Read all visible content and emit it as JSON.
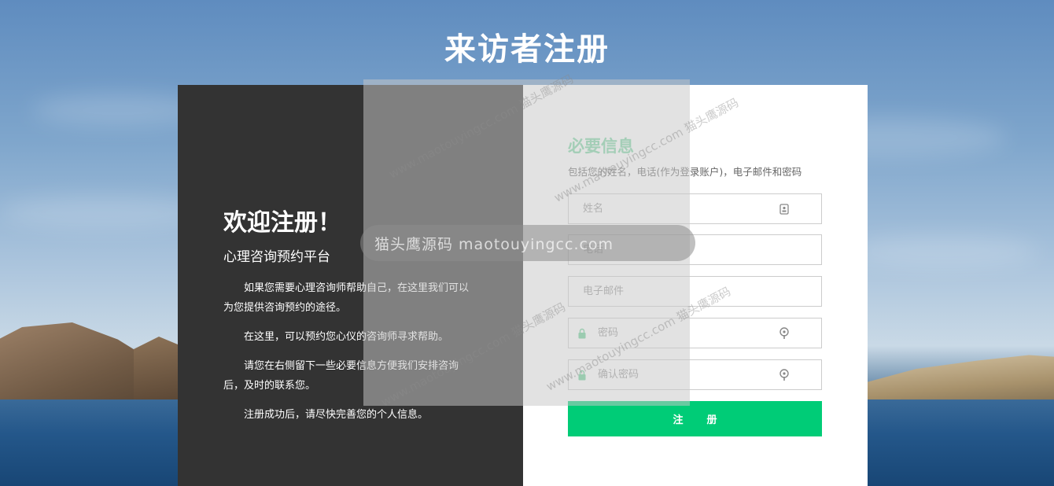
{
  "page": {
    "title": "来访者注册"
  },
  "left_panel": {
    "welcome": "欢迎注册！",
    "platform": "心理咨询预约平台",
    "paragraphs": [
      "如果您需要心理咨询师帮助自己，在这里我们可以为您提供咨询预约的途径。",
      "在这里，可以预约您心仪的咨询师寻求帮助。",
      "请您在右侧留下一些必要信息方便我们安排咨询后，及时的联系您。",
      "注册成功后，请尽快完善您的个人信息。"
    ]
  },
  "form": {
    "section_title": "必要信息",
    "section_desc": "包括您的姓名，电话(作为登录账户)，电子邮件和密码",
    "fields": {
      "name": {
        "placeholder": "姓名",
        "icon": "id-card-icon"
      },
      "phone": {
        "placeholder": "电话"
      },
      "email": {
        "placeholder": "电子邮件"
      },
      "password": {
        "placeholder": "密码",
        "icon": "lock-icon",
        "right_icon": "key-icon"
      },
      "confirm_password": {
        "placeholder": "确认密码",
        "icon": "lock-icon",
        "right_icon": "key-icon"
      }
    },
    "submit_label": "注册",
    "accent_color": "#00cc77",
    "title_color": "#7ed6a5"
  },
  "watermark": {
    "main": "猫头鹰源码 maotouyingcc.com",
    "small": "www.maotouyingcc.com 猫头鹰源码"
  }
}
